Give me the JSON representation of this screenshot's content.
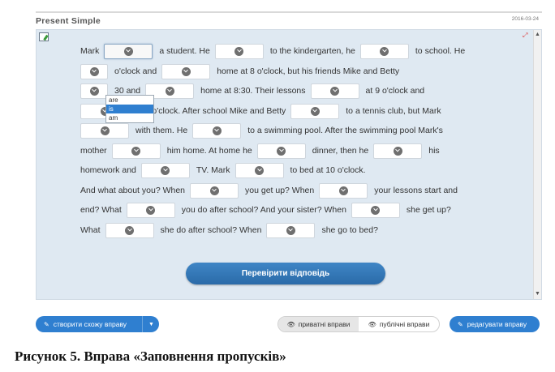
{
  "header": {
    "title": "Present Simple",
    "date": "2016-03-24"
  },
  "exercise": {
    "lines": [
      [
        {
          "t": "Mark"
        },
        {
          "s": 56,
          "active": true
        },
        {
          "t": "a student. He"
        },
        {
          "s": 56
        },
        {
          "t": "to the kindergarten, he"
        },
        {
          "s": 56
        },
        {
          "t": "to school. He"
        }
      ],
      [
        {
          "s": 30
        },
        {
          "t": "o'clock and"
        },
        {
          "s": 56
        },
        {
          "t": "home at 8 o'clock, but his friends Mike and Betty"
        }
      ],
      [
        {
          "s": 30
        },
        {
          "t": "30 and"
        },
        {
          "s": 56
        },
        {
          "t": "home at 8:30. Their lessons"
        },
        {
          "s": 56
        },
        {
          "t": "at 9 o'clock and"
        }
      ],
      [
        {
          "s": 56
        },
        {
          "t": "at 2 o'clock. After school Mike and Betty"
        },
        {
          "s": 56
        },
        {
          "t": "to a tennis club, but Mark"
        }
      ],
      [
        {
          "s": 56
        },
        {
          "t": "with them. He"
        },
        {
          "s": 56
        },
        {
          "t": "to a swimming pool. After the swimming pool Mark's"
        }
      ],
      [
        {
          "t": "mother"
        },
        {
          "s": 56
        },
        {
          "t": "him home. At home he"
        },
        {
          "s": 56
        },
        {
          "t": "dinner, then he"
        },
        {
          "s": 56
        },
        {
          "t": "his"
        }
      ],
      [
        {
          "t": "homework and"
        },
        {
          "s": 56
        },
        {
          "t": "TV. Mark"
        },
        {
          "s": 56
        },
        {
          "t": "to bed at 10 o'clock."
        }
      ],
      [
        {
          "t": "And what about you? When"
        },
        {
          "s": 56
        },
        {
          "t": "you get up? When"
        },
        {
          "s": 56
        },
        {
          "t": "your lessons start and"
        }
      ],
      [
        {
          "t": "end? What"
        },
        {
          "s": 56
        },
        {
          "t": "you do after school? And your sister? When"
        },
        {
          "s": 56
        },
        {
          "t": "she get up?"
        }
      ],
      [
        {
          "t": "What"
        },
        {
          "s": 56
        },
        {
          "t": "she do after school? When"
        },
        {
          "s": 56
        },
        {
          "t": "she go to bed?"
        }
      ]
    ],
    "dropdown_options": [
      "are",
      "is",
      "am"
    ],
    "dropdown_selected": "is",
    "check_button": "Перевірити відповідь"
  },
  "footer": {
    "create_label": "створити схожу вправу",
    "private_label": "приватні вправи",
    "public_label": "публічні вправи",
    "edit_label": "редагувати вправу"
  },
  "caption": "Рисунок 5. Вправа «Заповнення пропусків»",
  "colors": {
    "accent": "#2f7fd0",
    "panel": "#dfe9f2"
  }
}
